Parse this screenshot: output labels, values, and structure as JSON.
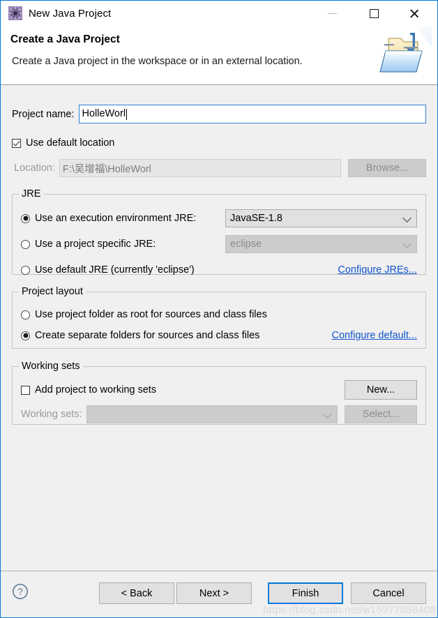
{
  "window": {
    "title": "New Java Project",
    "icon": "eclipse-wizard-icon",
    "controls": {
      "minimize": "—",
      "maximize": "□",
      "close": "✕"
    }
  },
  "header": {
    "title": "Create a Java Project",
    "description": "Create a Java project in the workspace or in an external location.",
    "banner_icon": "java-project-folder-icon"
  },
  "form": {
    "project_name_label": "Project name:",
    "project_name_value": "HolleWorl",
    "project_name_placeholder": "",
    "use_default_location_label": "Use default location",
    "use_default_location_checked": true,
    "location_label": "Location:",
    "location_value": "F:\\吴增福\\HolleWorl",
    "browse_label": "Browse..."
  },
  "jre": {
    "legend": "JRE",
    "options": [
      {
        "label": "Use an execution environment JRE:",
        "selected": true,
        "combo_value": "JavaSE-1.8",
        "combo_disabled": false
      },
      {
        "label": "Use a project specific JRE:",
        "selected": false,
        "combo_value": "eclipse",
        "combo_disabled": true
      },
      {
        "label": "Use default JRE (currently 'eclipse')",
        "selected": false
      }
    ],
    "configure_link": "Configure JREs..."
  },
  "project_layout": {
    "legend": "Project layout",
    "options": [
      {
        "label": "Use project folder as root for sources and class files",
        "selected": false
      },
      {
        "label": "Create separate folders for sources and class files",
        "selected": true
      }
    ],
    "configure_link": "Configure default..."
  },
  "working_sets": {
    "legend": "Working sets",
    "add_label": "Add project to working sets",
    "add_checked": false,
    "new_label": "New...",
    "sets_label": "Working sets:",
    "sets_value": "",
    "select_label": "Select..."
  },
  "footer": {
    "help_icon": "question-mark-icon",
    "back_label": "< Back",
    "next_label": "Next >",
    "finish_label": "Finish",
    "cancel_label": "Cancel",
    "watermark": "https://blog.csdn.net/w15977858408"
  },
  "colors": {
    "accent": "#0078d7",
    "link": "#1155cc",
    "dialog_bg": "#f0f0f0",
    "banner_bg": "#ffffff"
  }
}
